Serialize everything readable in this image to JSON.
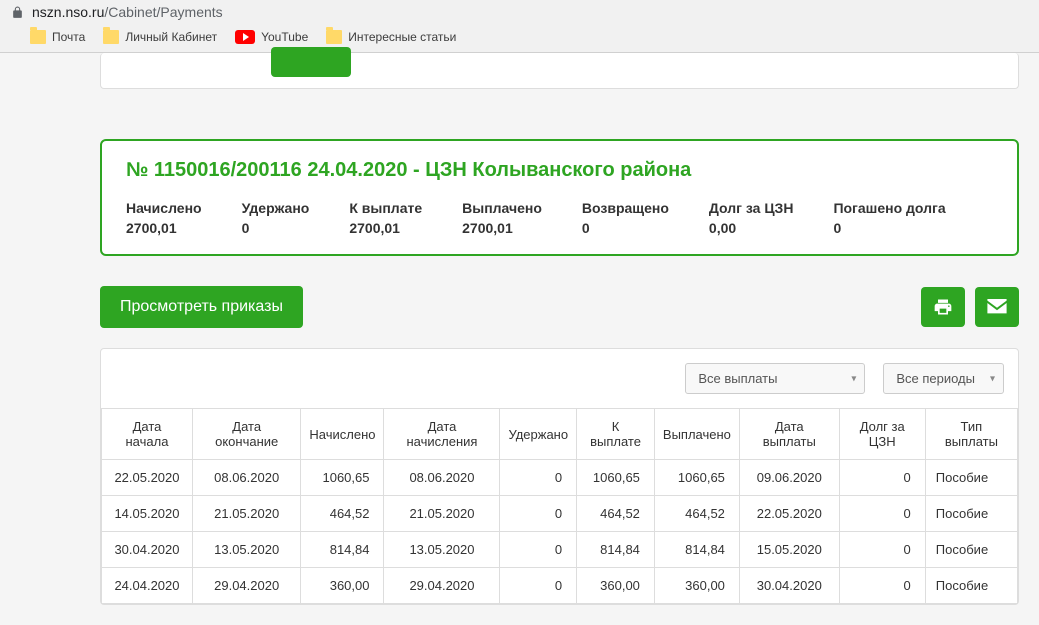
{
  "browser": {
    "url_domain": "nszn.nso.ru",
    "url_path": "/Cabinet/Payments",
    "bookmarks": [
      {
        "label": "Почта",
        "icon": "folder"
      },
      {
        "label": "Личный Кабинет",
        "icon": "folder"
      },
      {
        "label": "YouTube",
        "icon": "youtube"
      },
      {
        "label": "Интересные статьи",
        "icon": "folder"
      }
    ]
  },
  "summary": {
    "title": "№ 1150016/200116 24.04.2020 - ЦЗН Колыванского района",
    "items": [
      {
        "label": "Начислено",
        "value": "2700,01"
      },
      {
        "label": "Удержано",
        "value": "0"
      },
      {
        "label": "К выплате",
        "value": "2700,01"
      },
      {
        "label": "Выплачено",
        "value": "2700,01"
      },
      {
        "label": "Возвращено",
        "value": "0"
      },
      {
        "label": "Долг за ЦЗН",
        "value": "0,00"
      },
      {
        "label": "Погашено долга",
        "value": "0"
      }
    ]
  },
  "actions": {
    "view_orders": "Просмотреть приказы"
  },
  "filters": {
    "payments": "Все выплаты",
    "periods": "Все периоды"
  },
  "table": {
    "headers": [
      "Дата начала",
      "Дата окончание",
      "Начислено",
      "Дата начисления",
      "Удержано",
      "К выплате",
      "Выплачено",
      "Дата выплаты",
      "Долг за ЦЗН",
      "Тип выплаты"
    ],
    "rows": [
      {
        "start": "22.05.2020",
        "end": "08.06.2020",
        "accrued": "1060,65",
        "accrual_date": "08.06.2020",
        "withheld": "0",
        "to_pay": "1060,65",
        "paid": "1060,65",
        "pay_date": "09.06.2020",
        "debt": "0",
        "type": "Пособие"
      },
      {
        "start": "14.05.2020",
        "end": "21.05.2020",
        "accrued": "464,52",
        "accrual_date": "21.05.2020",
        "withheld": "0",
        "to_pay": "464,52",
        "paid": "464,52",
        "pay_date": "22.05.2020",
        "debt": "0",
        "type": "Пособие"
      },
      {
        "start": "30.04.2020",
        "end": "13.05.2020",
        "accrued": "814,84",
        "accrual_date": "13.05.2020",
        "withheld": "0",
        "to_pay": "814,84",
        "paid": "814,84",
        "pay_date": "15.05.2020",
        "debt": "0",
        "type": "Пособие"
      },
      {
        "start": "24.04.2020",
        "end": "29.04.2020",
        "accrued": "360,00",
        "accrual_date": "29.04.2020",
        "withheld": "0",
        "to_pay": "360,00",
        "paid": "360,00",
        "pay_date": "30.04.2020",
        "debt": "0",
        "type": "Пособие"
      }
    ]
  }
}
